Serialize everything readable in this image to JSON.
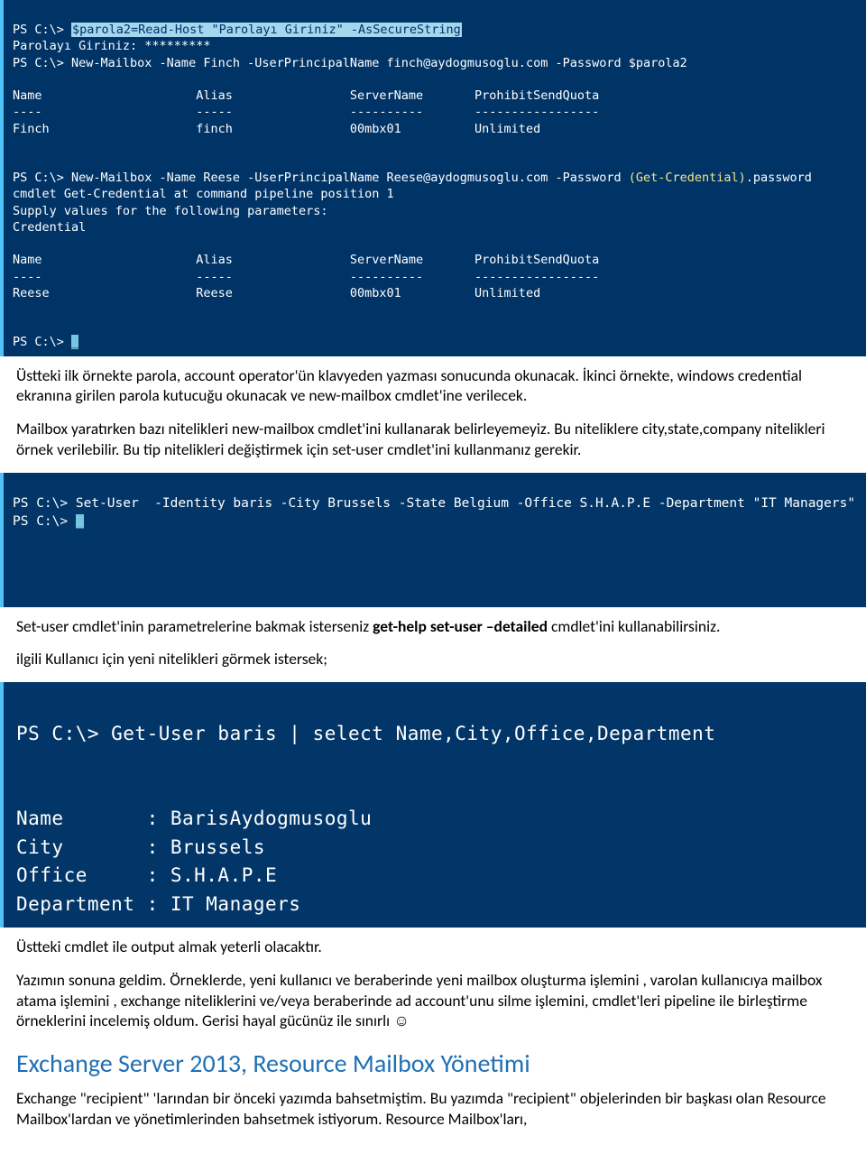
{
  "term1": {
    "l1a": "PS C:\\> ",
    "l1b": "$parola2=Read-Host \"Parolayı Giriniz\" -AsSecureString",
    "l2": "Parolayı Giriniz: *********",
    "l3": "PS C:\\> New-Mailbox -Name Finch -UserPrincipalName finch@aydogmusoglu.com -Password $parola2",
    "blank": " ",
    "hdr1": "Name                     Alias                ServerName       ProhibitSendQuota",
    "hdr1u": "----                     -----                ----------       -----------------",
    "row1": "Finch                    finch                00mbx01          Unlimited",
    "l4a": "PS C:\\> New-Mailbox -Name Reese -UserPrincipalName Reese@aydogmusoglu.com -Password ",
    "l4b": "(Get-Credential)",
    "l4c": ".password",
    "l5": "cmdlet Get-Credential at command pipeline position 1",
    "l6": "Supply values for the following parameters:",
    "l7": "Credential",
    "hdr2": "Name                     Alias                ServerName       ProhibitSendQuota",
    "hdr2u": "----                     -----                ----------       -----------------",
    "row2": "Reese                    Reese                00mbx01          Unlimited",
    "prompt": "PS C:\\> ",
    "cursor": "_"
  },
  "p1": "Üstteki ilk örnekte parola, account operator'ün klavyeden yazması sonucunda okunacak. İkinci örnekte, windows credential ekranına girilen parola kutucuğu okunacak ve new-mailbox cmdlet'ine verilecek.",
  "p2": "Mailbox yaratırken bazı nitelikleri new-mailbox cmdlet'ini kullanarak belirleyemeyiz. Bu niteliklere city,state,company nitelikleri örnek verilebilir. Bu tip nitelikleri değiştirmek için set-user cmdlet'ini kullanmanız gerekir.",
  "term2": {
    "l1": "PS C:\\> Set-User  -Identity baris -City Brussels -State Belgium -Office S.H.A.P.E -Department \"IT Managers\"",
    "prompt": "PS C:\\> ",
    "cursor": "_"
  },
  "p3a": "Set-user cmdlet'inin parametrelerine bakmak isterseniz ",
  "p3b": "get-help set-user –detailed",
  "p3c": " cmdlet'ini kullanabilirsiniz.",
  "p4": "ilgili Kullanıcı için yeni nitelikleri görmek istersek;",
  "term3": {
    "l1": "PS C:\\> Get-User baris | select Name,City,Office,Department",
    "blank": " ",
    "r1": "Name       : BarisAydogmusoglu",
    "r2": "City       : Brussels",
    "r3": "Office     : S.H.A.P.E",
    "r4": "Department : IT Managers"
  },
  "p5": "Üstteki cmdlet ile output almak yeterli olacaktır.",
  "p6": "Yazımın sonuna geldim. Örneklerde, yeni kullanıcı ve beraberinde yeni mailbox oluşturma işlemini , varolan kullanıcıya mailbox atama işlemini , exchange niteliklerini ve/veya beraberinde ad account'unu silme işlemini, cmdlet'leri pipeline ile birleştirme örneklerini incelemiş oldum. Gerisi hayal gücünüz ile sınırlı ☺",
  "heading": "Exchange Server 2013, Resource Mailbox Yönetimi",
  "p7": "Exchange \"recipient\" 'larından bir önceki yazımda bahsetmiştim. Bu yazımda \"recipient\" objelerinden bir başkası olan Resource Mailbox'lardan ve yönetimlerinden bahsetmek istiyorum. Resource Mailbox'ları,"
}
